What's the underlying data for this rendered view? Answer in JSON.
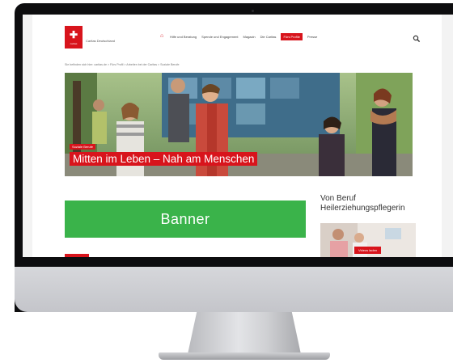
{
  "website": {
    "logo": {
      "icon": "caritas-flame-cross-icon",
      "text": "caritas"
    },
    "org_name": "Caritas Deutschland",
    "nav": {
      "home_icon": "house-icon",
      "items": [
        {
          "label": "Hilfe und Beratung"
        },
        {
          "label": "Spende und Engagement"
        },
        {
          "label": "Magazin"
        },
        {
          "label": "Die Caritas"
        },
        {
          "label": "Fürs Profile",
          "active": true
        },
        {
          "label": "Presse"
        }
      ],
      "search_icon": "search-icon"
    },
    "breadcrumb": "Sie befinden sich hier: caritas.de > Fürs Profil > Arbeiten bei der Caritas > Soziale Berufe",
    "hero": {
      "kicker": "Soziale Berufe",
      "headline": "Mitten im Leben – Nah am Menschen"
    },
    "banner": {
      "label": "Banner"
    },
    "aside": {
      "title": "Von Beruf Heilerziehungspflegerin",
      "button_label": "Videos laden"
    }
  },
  "colors": {
    "accent": "#d8141c",
    "banner": "#3ab34a",
    "bezel": "#0d0d0f",
    "monitor_chin": "#c9cacf"
  }
}
